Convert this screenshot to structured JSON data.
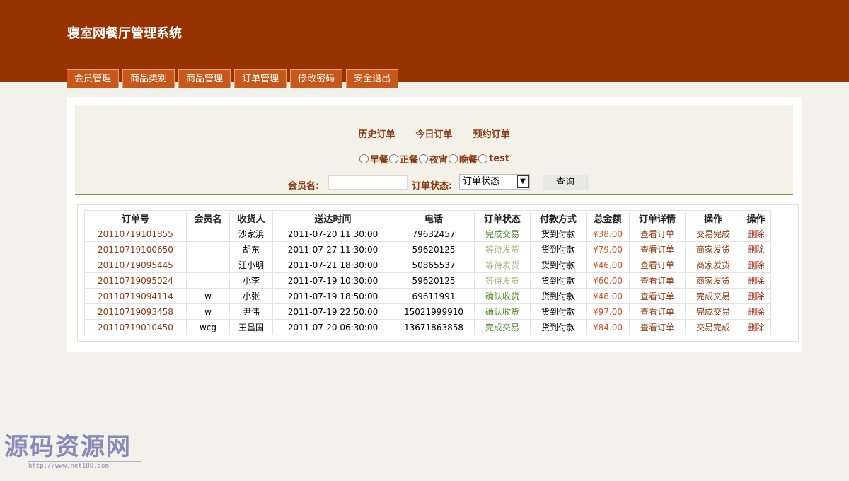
{
  "header": {
    "title": "寝室网餐厅管理系统",
    "tabs": [
      "会员管理",
      "商品类别",
      "商品管理",
      "订单管理",
      "修改密码",
      "安全退出"
    ]
  },
  "filters": {
    "order_links": [
      "历史订单",
      "今日订单",
      "预约订单"
    ],
    "meals": [
      "早餐",
      "正餐",
      "夜宵",
      "晚餐",
      "test"
    ],
    "member_label": "会员名:",
    "member_value": "",
    "status_label": "订单状态:",
    "status_selected": "订单状态",
    "query_label": "查询"
  },
  "table": {
    "headers": [
      "订单号",
      "会员名",
      "收货人",
      "送达时间",
      "电话",
      "订单状态",
      "付款方式",
      "总金额",
      "订单详情",
      "操作",
      "操作"
    ],
    "rows": [
      {
        "order_no": "20110719101855",
        "member": "",
        "receiver": "沙家浜",
        "time": "2011-07-20 11:30:00",
        "phone": "79632457",
        "status": "完成交易",
        "pay": "货到付款",
        "amount": "¥38.00",
        "detail": "查看订单",
        "action": "交易完成",
        "delete": "删除"
      },
      {
        "order_no": "20110719100650",
        "member": "",
        "receiver": "胡东",
        "time": "2011-07-27 11:30:00",
        "phone": "59620125",
        "status": "等待发货",
        "pay": "货到付款",
        "amount": "¥79.00",
        "detail": "查看订单",
        "action": "商家发货",
        "delete": "删除"
      },
      {
        "order_no": "20110719095445",
        "member": "",
        "receiver": "汪小明",
        "time": "2011-07-21 18:30:00",
        "phone": "50865537",
        "status": "等待发货",
        "pay": "货到付款",
        "amount": "¥46.00",
        "detail": "查看订单",
        "action": "商家发货",
        "delete": "删除"
      },
      {
        "order_no": "20110719095024",
        "member": "",
        "receiver": "小李",
        "time": "2011-07-19 10:30:00",
        "phone": "59620125",
        "status": "等待发货",
        "pay": "货到付款",
        "amount": "¥60.00",
        "detail": "查看订单",
        "action": "商家发货",
        "delete": "删除"
      },
      {
        "order_no": "20110719094114",
        "member": "w",
        "receiver": "小张",
        "time": "2011-07-19 18:50:00",
        "phone": "69611991",
        "status": "确认收货",
        "pay": "货到付款",
        "amount": "¥48.00",
        "detail": "查看订单",
        "action": "完成交易",
        "delete": "删除"
      },
      {
        "order_no": "20110719093458",
        "member": "w",
        "receiver": "尹伟",
        "time": "2011-07-19 22:50:00",
        "phone": "15021999910",
        "status": "确认收货",
        "pay": "货到付款",
        "amount": "¥97.00",
        "detail": "查看订单",
        "action": "完成交易",
        "delete": "删除"
      },
      {
        "order_no": "20110719010450",
        "member": "wcg",
        "receiver": "王昌国",
        "time": "2011-07-20 06:30:00",
        "phone": "13671863858",
        "status": "完成交易",
        "pay": "货到付款",
        "amount": "¥84.00",
        "detail": "查看订单",
        "action": "交易完成",
        "delete": "删除"
      }
    ]
  },
  "watermark": {
    "text": "源码资源网",
    "url": "http://www.net188.com"
  },
  "colors": {
    "header_bg": "#963300",
    "tab_bg": "#c8571a",
    "link": "#8a3a10",
    "amount": "#d05020",
    "divider": "#6a9f4c"
  }
}
